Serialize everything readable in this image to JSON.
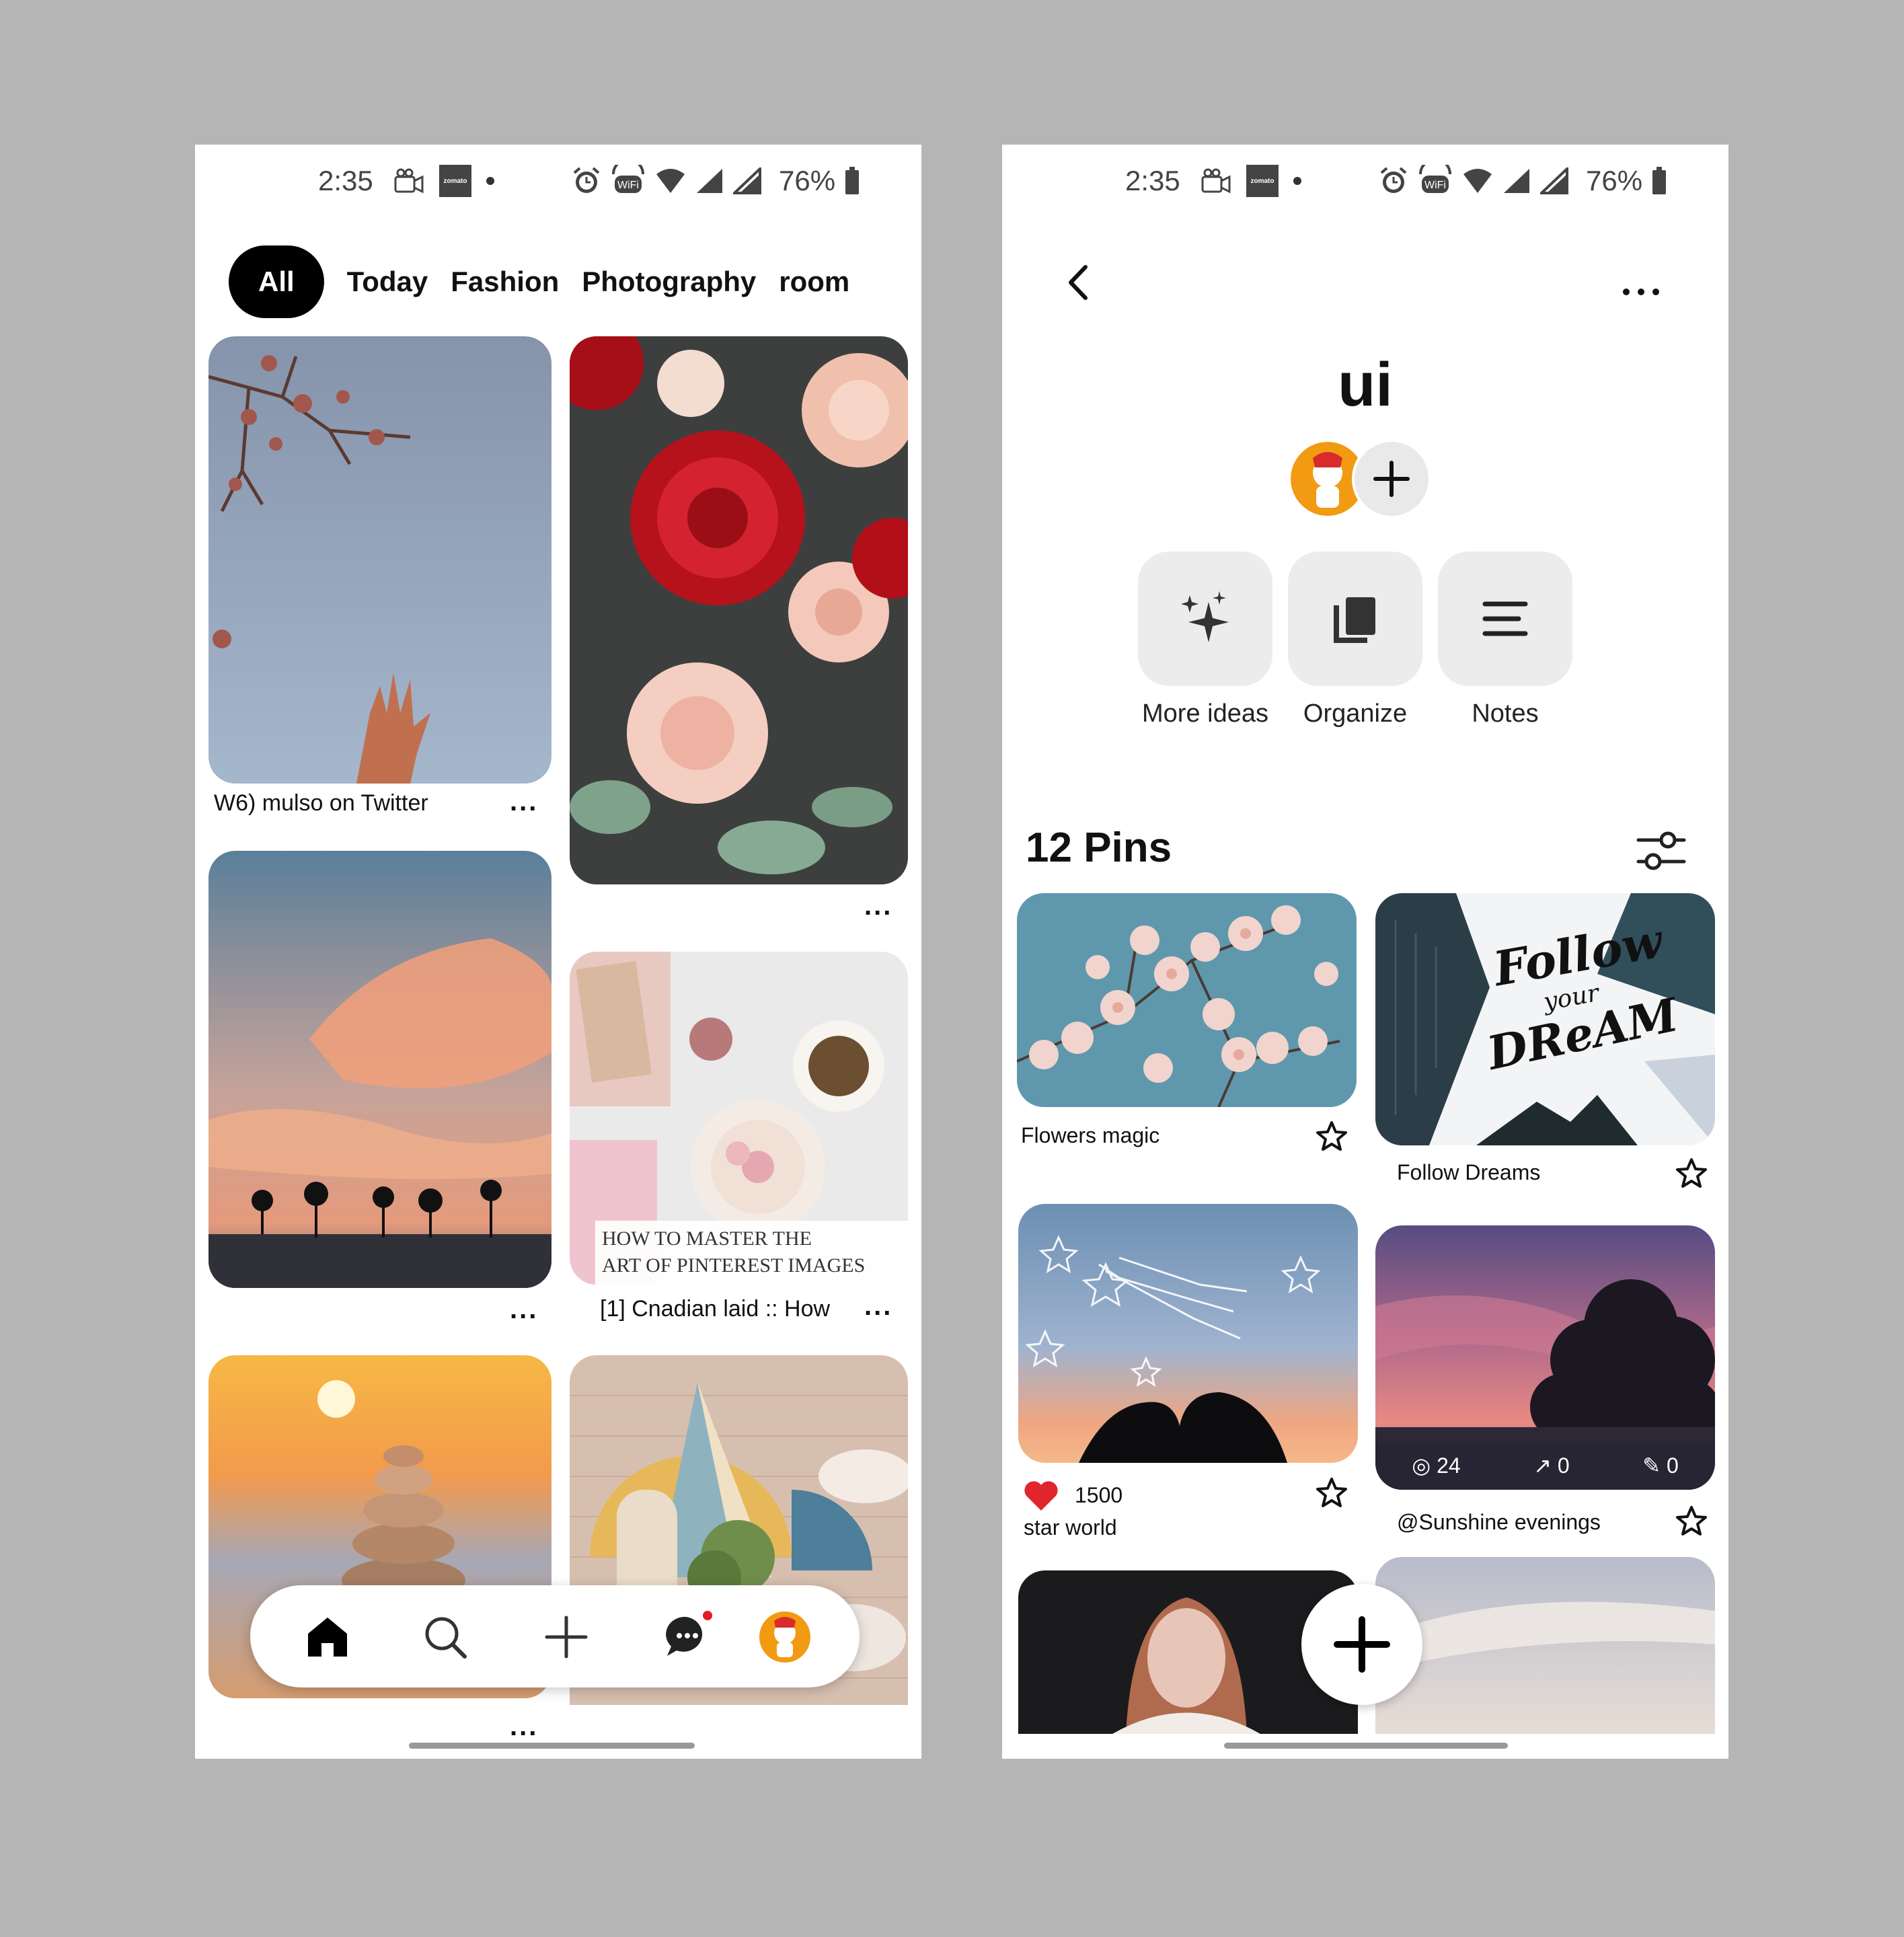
{
  "status_bar": {
    "time": "2:35",
    "battery": "76%",
    "zomato": "zomato"
  },
  "home_feed": {
    "tabs": [
      "All",
      "Today",
      "Fashion",
      "Photography",
      "room"
    ],
    "pins": [
      {
        "caption": "W6) mulso on Twitter",
        "more": "..."
      },
      {
        "caption": "",
        "more": "..."
      },
      {
        "caption": "",
        "more": "..."
      },
      {
        "caption": "[1] Cnadian laid :: How",
        "more": "...",
        "overlay_text_1": "HOW TO MASTER THE",
        "overlay_text_2": "ART OF PINTEREST IMAGES"
      },
      {
        "caption": "",
        "more": "..."
      }
    ],
    "nav": [
      "home-icon",
      "search-icon",
      "plus-icon",
      "messages-icon",
      "profile-avatar"
    ]
  },
  "board": {
    "title": "ui",
    "actions": [
      {
        "label": "More ideas",
        "icon": "sparkle-icon"
      },
      {
        "label": "Organize",
        "icon": "copy-icon"
      },
      {
        "label": "Notes",
        "icon": "notes-icon"
      }
    ],
    "pins_count": "12 Pins",
    "pins": [
      {
        "title": "Flowers magic"
      },
      {
        "title": "Follow Dreams",
        "overlay_text_1": "Follow",
        "overlay_text_2": "your",
        "overlay_text_3": "DReAM"
      },
      {
        "title": "star world",
        "likes": "1500"
      },
      {
        "title": "@Sunshine evenings",
        "views": "24",
        "shares": "0",
        "saves": "0"
      }
    ]
  },
  "colors": {
    "accent": "#000000",
    "like": "#e0262c",
    "chip_bg": "#ececec"
  }
}
